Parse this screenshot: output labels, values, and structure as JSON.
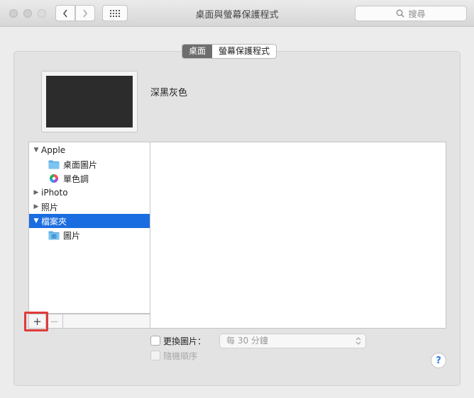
{
  "window": {
    "title": "桌面與螢幕保護程式"
  },
  "toolbar": {
    "search_placeholder": "搜尋",
    "back_icon": "chevron-left-icon",
    "forward_icon": "chevron-right-icon",
    "grid_icon": "grid-icon"
  },
  "tabs": [
    {
      "label": "桌面",
      "active": true
    },
    {
      "label": "螢幕保護程式",
      "active": false
    }
  ],
  "preview": {
    "name": "深黑灰色",
    "color": "#2c2c2c"
  },
  "sidebar": {
    "items": [
      {
        "label": "Apple",
        "disclosure": "▼",
        "level": 0,
        "icon": "",
        "selected": false
      },
      {
        "label": "桌面圖片",
        "disclosure": "",
        "level": 1,
        "icon": "folder-icon",
        "selected": false
      },
      {
        "label": "單色調",
        "disclosure": "",
        "level": 1,
        "icon": "color-wheel-icon",
        "selected": false
      },
      {
        "label": "iPhoto",
        "disclosure": "▶",
        "level": 0,
        "icon": "",
        "selected": false
      },
      {
        "label": "照片",
        "disclosure": "▶",
        "level": 0,
        "icon": "",
        "selected": false
      },
      {
        "label": "檔案夾",
        "disclosure": "▼",
        "level": 0,
        "icon": "",
        "selected": true
      },
      {
        "label": "圖片",
        "disclosure": "",
        "level": 1,
        "icon": "pictures-folder-icon",
        "selected": false
      }
    ],
    "add_label": "+",
    "remove_label": "−"
  },
  "options": {
    "change_picture_label": "更換圖片：",
    "interval_value": "每 30 分鐘",
    "random_order_label": "隨機順序"
  },
  "help_label": "?",
  "colors": {
    "selection": "#1a6de0",
    "highlight_box": "#e03a3a",
    "folder_blue": "#5fb4ec"
  }
}
